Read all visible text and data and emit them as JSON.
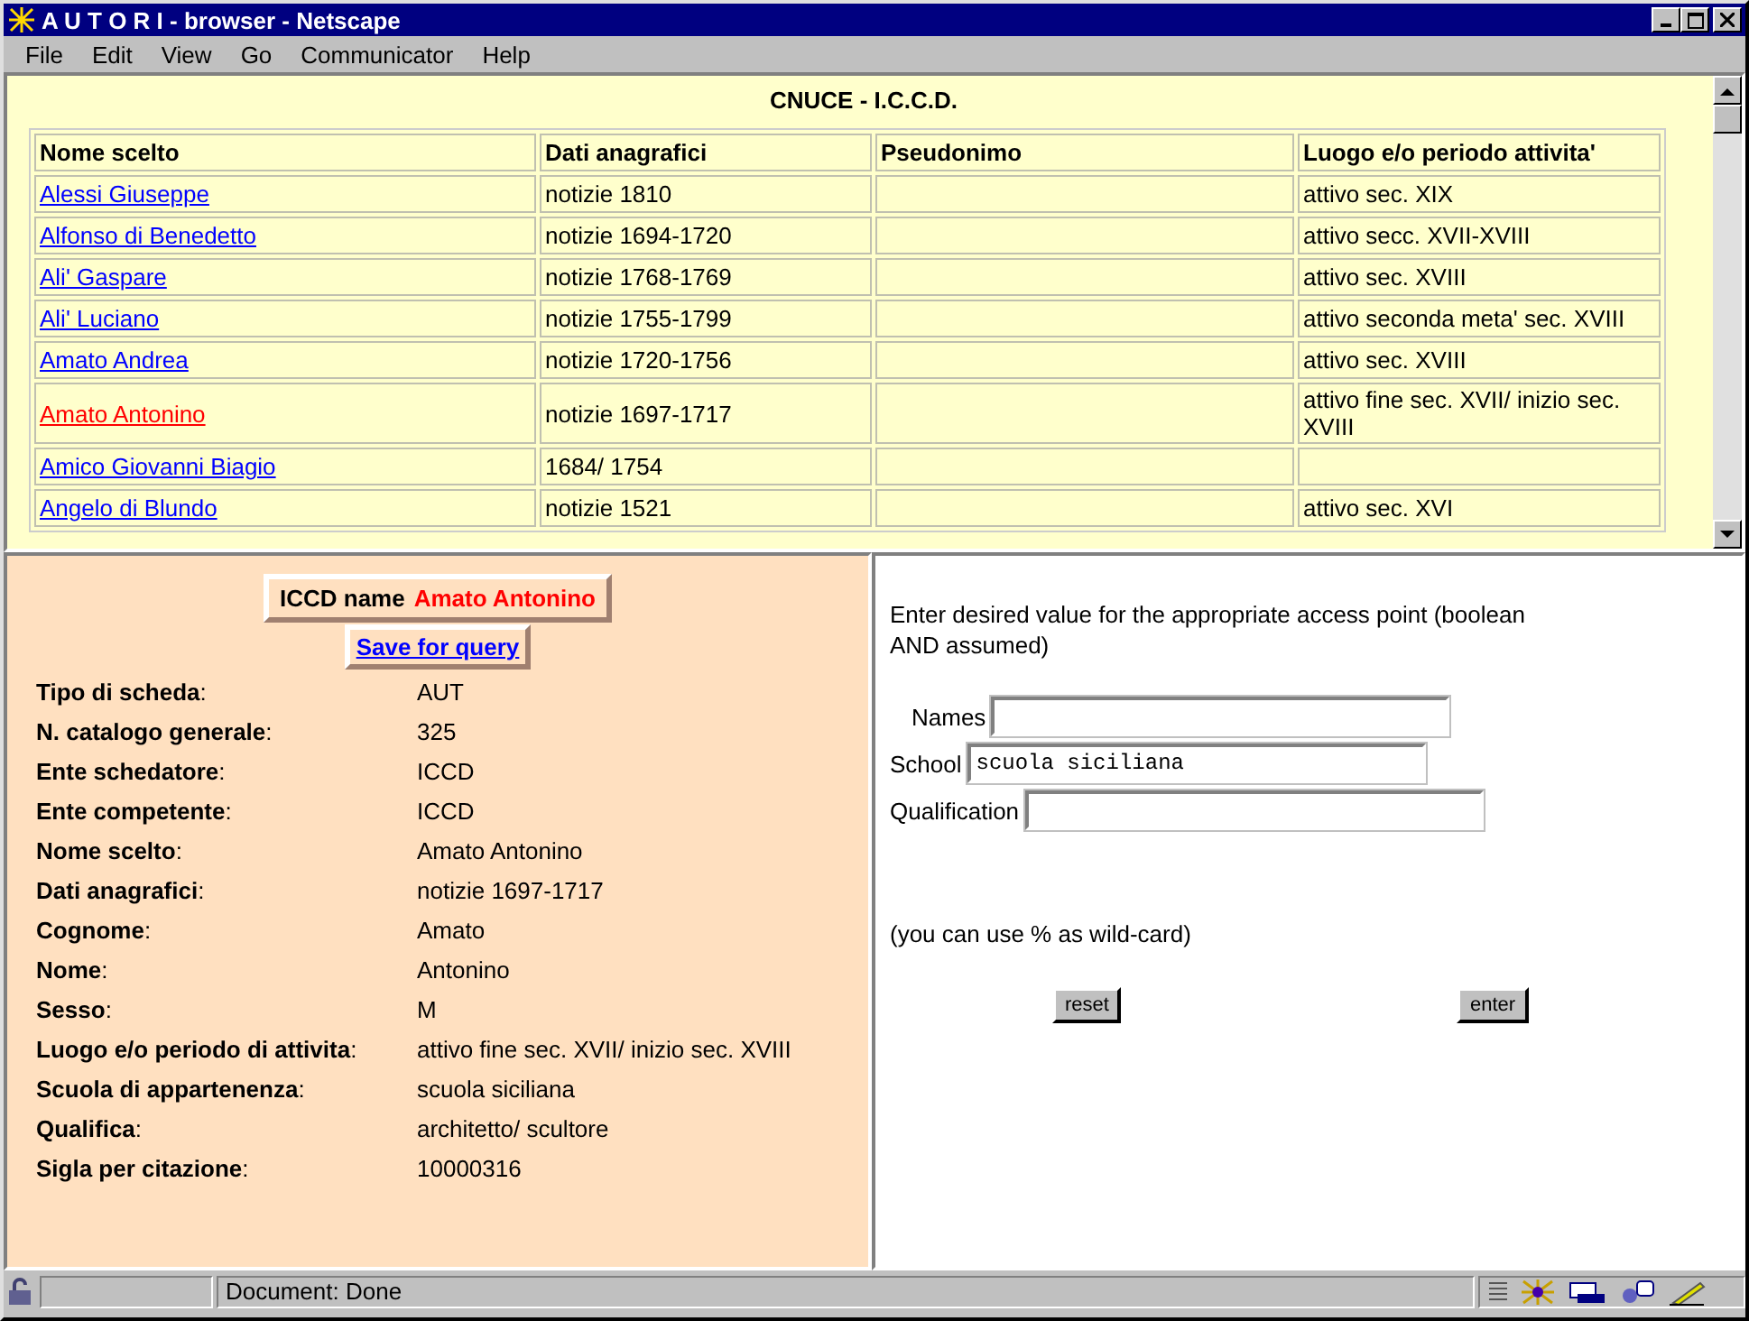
{
  "window": {
    "title": "A U T O R I - browser - Netscape"
  },
  "menu": [
    "File",
    "Edit",
    "View",
    "Go",
    "Communicator",
    "Help"
  ],
  "top_frame": {
    "heading": "CNUCE - I.C.C.D.",
    "table": {
      "columns": [
        "Nome scelto",
        "Dati anagrafici",
        "Pseudonimo",
        "Luogo e/o periodo attivita'"
      ],
      "rows": [
        {
          "name": "Alessi Giuseppe",
          "dates": "notizie 1810",
          "luogo": "attivo sec. XIX",
          "selected": false
        },
        {
          "name": "Alfonso di Benedetto",
          "dates": "notizie 1694-1720",
          "luogo": "attivo secc. XVII-XVIII",
          "selected": false
        },
        {
          "name": "Ali' Gaspare",
          "dates": "notizie 1768-1769",
          "luogo": "attivo sec. XVIII",
          "selected": false
        },
        {
          "name": "Ali' Luciano",
          "dates": "notizie 1755-1799",
          "luogo": "attivo seconda meta' sec. XVIII",
          "selected": false
        },
        {
          "name": "Amato Andrea",
          "dates": "notizie 1720-1756",
          "luogo": "attivo sec. XVIII",
          "selected": false
        },
        {
          "name": "Amato Antonino",
          "dates": "notizie 1697-1717",
          "luogo": "attivo fine sec. XVII/ inizio sec. XVIII",
          "selected": true
        },
        {
          "name": "Amico Giovanni Biagio",
          "dates": "1684/ 1754",
          "selected": false
        },
        {
          "name": "Angelo di Blundo",
          "dates": "notizie 1521",
          "luogo": "attivo sec. XVI",
          "selected": false
        }
      ]
    }
  },
  "detail_frame": {
    "name_label": "ICCD name",
    "name_value": "Amato Antonino",
    "save_link": "Save for query",
    "fields": [
      {
        "label": "**Tipo di scheda**:",
        "value": "AUT"
      },
      {
        "label": "**N. catalogo generale**:",
        "value": "325"
      },
      {
        "label": "**Ente schedatore**:",
        "value": "ICCD"
      },
      {
        "label": "**Ente competente**:",
        "value": "ICCD"
      },
      {
        "label": "**Nome scelto**:",
        "value": "Amato Antonino"
      },
      {
        "label": "**Dati anagrafici**:",
        "value": "notizie 1697-1717"
      },
      {
        "label": "**Cognome**:",
        "value": "Amato"
      },
      {
        "label": "**Nome**:",
        "value": "Antonino"
      },
      {
        "label": "**Sesso**:",
        "value": "M"
      },
      {
        "label": "**Luogo e/o periodo di attivita**:",
        "value": "attivo fine sec. XVII/ inizio sec. XVIII"
      },
      {
        "label": "**Scuola di appartenenza**:",
        "value": "scuola siciliana"
      },
      {
        "label": "**Qualifica**:",
        "value": "architetto/ scultore"
      },
      {
        "label": "**Sigla per citazione**:",
        "value": "10000316"
      }
    ]
  },
  "query_frame": {
    "intro": "Enter desired value for the appropriate access point (boolean AND assumed)",
    "inputs": [
      {
        "label": "Names"
      },
      {
        "label": "School",
        "value": "scuola siciliana"
      },
      {
        "label": "Qualification"
      }
    ],
    "hint": "(you can use % as wild-card)",
    "buttons": [
      "reset",
      "enter"
    ]
  },
  "status_bar": {
    "text": "Document: Done"
  }
}
